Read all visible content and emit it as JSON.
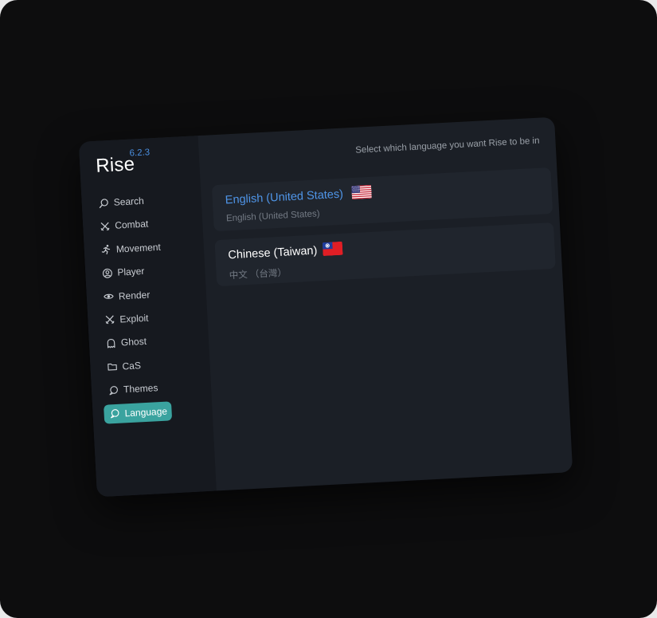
{
  "app": {
    "name": "Rise",
    "version": "6.2.3"
  },
  "sidebar": {
    "items": [
      {
        "label": "Search",
        "icon": "search-icon",
        "active": false
      },
      {
        "label": "Combat",
        "icon": "crossed-swords-icon",
        "active": false
      },
      {
        "label": "Movement",
        "icon": "running-icon",
        "active": false
      },
      {
        "label": "Player",
        "icon": "user-circle-icon",
        "active": false
      },
      {
        "label": "Render",
        "icon": "eye-icon",
        "active": false
      },
      {
        "label": "Exploit",
        "icon": "crossed-swords-icon",
        "active": false
      },
      {
        "label": "Ghost",
        "icon": "ghost-icon",
        "active": false
      },
      {
        "label": "CaS",
        "icon": "folder-icon",
        "active": false
      },
      {
        "label": "Themes",
        "icon": "chat-bubble-icon",
        "active": false
      },
      {
        "label": "Language",
        "icon": "chat-bubble-icon",
        "active": true
      }
    ]
  },
  "main": {
    "header": "Select which language you want Rise to be in",
    "languages": [
      {
        "name": "English (United States)",
        "native": "English (United States)",
        "flag": "us-flag-icon",
        "selected": true
      },
      {
        "name": "Chinese (Taiwan)",
        "native": "中文 （台灣）",
        "flag": "taiwan-flag-icon",
        "selected": false
      }
    ]
  },
  "colors": {
    "accent": "#3aa39f",
    "selected_text": "#4f95e8",
    "panel_bg": "#1b1f26",
    "sidebar_bg": "#16191f",
    "card_bg": "#20252d"
  }
}
